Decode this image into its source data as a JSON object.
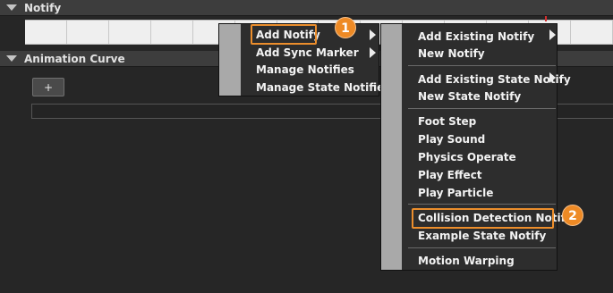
{
  "notify_section": {
    "title": "Notify"
  },
  "curve_section": {
    "title": "Animation Curve",
    "add_button": "+"
  },
  "menu1": {
    "items": [
      "Add Notify",
      "Add Sync Marker",
      "Manage Notifies",
      "Manage State Notifies"
    ]
  },
  "menu2": {
    "items": [
      "Add Existing Notify",
      "New Notify",
      "Add Existing State Notify",
      "New State Notify",
      "Foot Step",
      "Play Sound",
      "Physics Operate",
      "Play Effect",
      "Play Particle",
      "Collision Detection Notify",
      "Example State Notify",
      "Motion Warping"
    ]
  },
  "badges": [
    "1",
    "2"
  ],
  "colors": {
    "accent": "#ee8a25",
    "track": "#efefef",
    "marker": "#d23030"
  }
}
